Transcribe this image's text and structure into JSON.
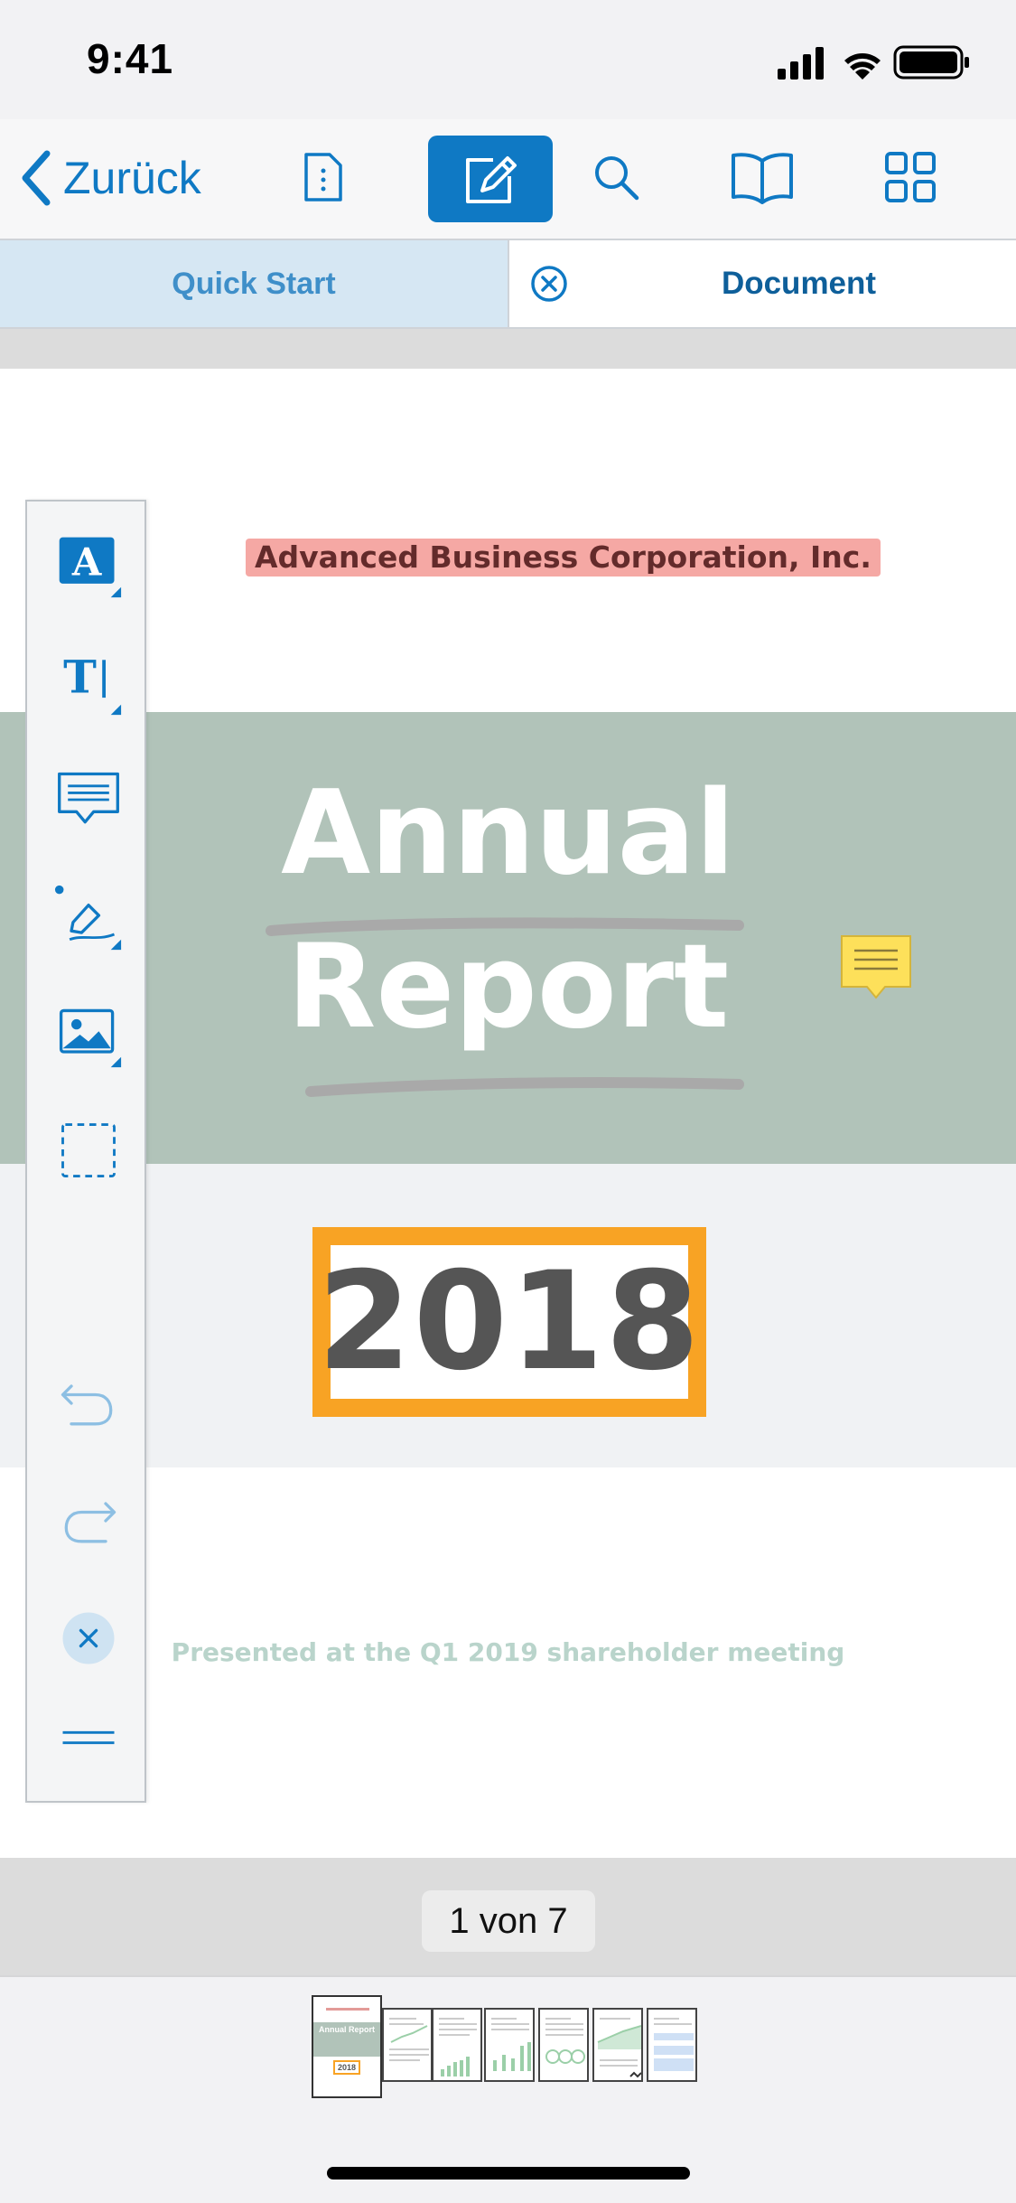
{
  "status_bar": {
    "time": "9:41"
  },
  "navbar": {
    "back_label": "Zurück",
    "icons": [
      "document-outline-icon",
      "edit-pencil-icon",
      "search-icon",
      "book-icon",
      "grid-icon"
    ]
  },
  "tabs": [
    {
      "label": "Quick Start",
      "active": false
    },
    {
      "label": "Document",
      "active": true
    }
  ],
  "document": {
    "company": "Advanced Business Corporation, Inc.",
    "title_line1": "Annual",
    "title_line2": "Report",
    "year": "2018",
    "presented": "Presented at the Q1 2019 shareholder meeting",
    "colors": {
      "band": "#b1c3b9",
      "year_border": "#f8a324",
      "company_highlight": "#f5a8a4",
      "note": "#fde05a"
    }
  },
  "toolbar": {
    "tools": [
      "highlight-text-icon",
      "text-tool-icon",
      "comment-icon",
      "ink-pen-icon",
      "image-icon",
      "selection-rect-icon",
      "undo-icon",
      "redo-icon",
      "close-icon",
      "drag-handle-icon"
    ]
  },
  "pager": {
    "label": "1 von 7",
    "current": 1,
    "total": 7
  },
  "thumbnails": {
    "count": 7,
    "thumb1_title": "Annual Report",
    "thumb1_year": "2018"
  },
  "accent": "#0f79c4"
}
